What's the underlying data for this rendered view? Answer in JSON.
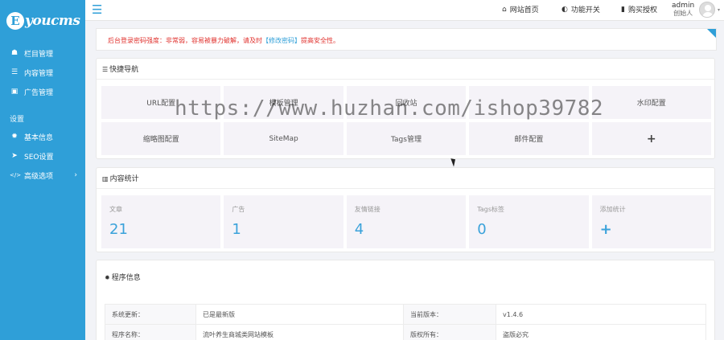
{
  "sidebar": {
    "logo": {
      "letter": "E",
      "text": "youcms"
    },
    "items": [
      {
        "icon": "sitemap-icon",
        "glyph": "☗",
        "label": "栏目管理"
      },
      {
        "icon": "list-icon",
        "glyph": "☰",
        "label": "内容管理"
      },
      {
        "icon": "image-icon",
        "glyph": "▣",
        "label": "广告管理"
      }
    ],
    "section_label": "设置",
    "settings_items": [
      {
        "icon": "gear-icon",
        "glyph": "✹",
        "label": "基本信息"
      },
      {
        "icon": "paper-plane-icon",
        "glyph": "➤",
        "label": "SEO设置"
      },
      {
        "icon": "code-icon",
        "glyph": "</>",
        "label": "高级选项",
        "chevron": "›"
      }
    ]
  },
  "header": {
    "menu_glyph": "☰",
    "links": [
      {
        "icon": "home-icon",
        "glyph": "⌂",
        "label": "网站首页"
      },
      {
        "icon": "toggle-icon",
        "glyph": "◐",
        "label": "功能开关"
      },
      {
        "icon": "bookmark-icon",
        "glyph": "▮",
        "label": "购买授权"
      }
    ],
    "user": {
      "name": "admin",
      "role": "创始人"
    },
    "caret": "▾"
  },
  "alert": {
    "text_before": "后台登录密码强度：非常弱，容易被暴力破解，请及时",
    "link": "【修改密码】",
    "text_after": "提高安全性。"
  },
  "quick_nav": {
    "title_glyph": "☰",
    "title": "快捷导航",
    "items": [
      "URL配置",
      "模板管理",
      "回收站",
      "",
      "水印配置",
      "缩略图配置",
      "SiteMap",
      "Tags管理",
      "邮件配置"
    ],
    "add_glyph": "+"
  },
  "stats": {
    "title_glyph": "▥",
    "title": "内容统计",
    "items": [
      {
        "label": "文章",
        "value": "21"
      },
      {
        "label": "广告",
        "value": "1"
      },
      {
        "label": "友情链接",
        "value": "4"
      },
      {
        "label": "Tags标签",
        "value": "0"
      },
      {
        "label": "添加统计",
        "value": "+"
      }
    ]
  },
  "program_info": {
    "title_glyph": "✹",
    "title": "程序信息",
    "rows": [
      [
        "系统更新：",
        "已是最新版",
        "当前版本：",
        "v1.4.6"
      ],
      [
        "程序名称：",
        "流叶养生商城类网站模板",
        "版权所有：",
        "盗版必究"
      ]
    ]
  },
  "watermark": "https://www.huzhan.com/ishop39782",
  "colors": {
    "accent": "#2f9fd8",
    "alert": "#e0322e",
    "stat_value": "#3aa2da"
  }
}
